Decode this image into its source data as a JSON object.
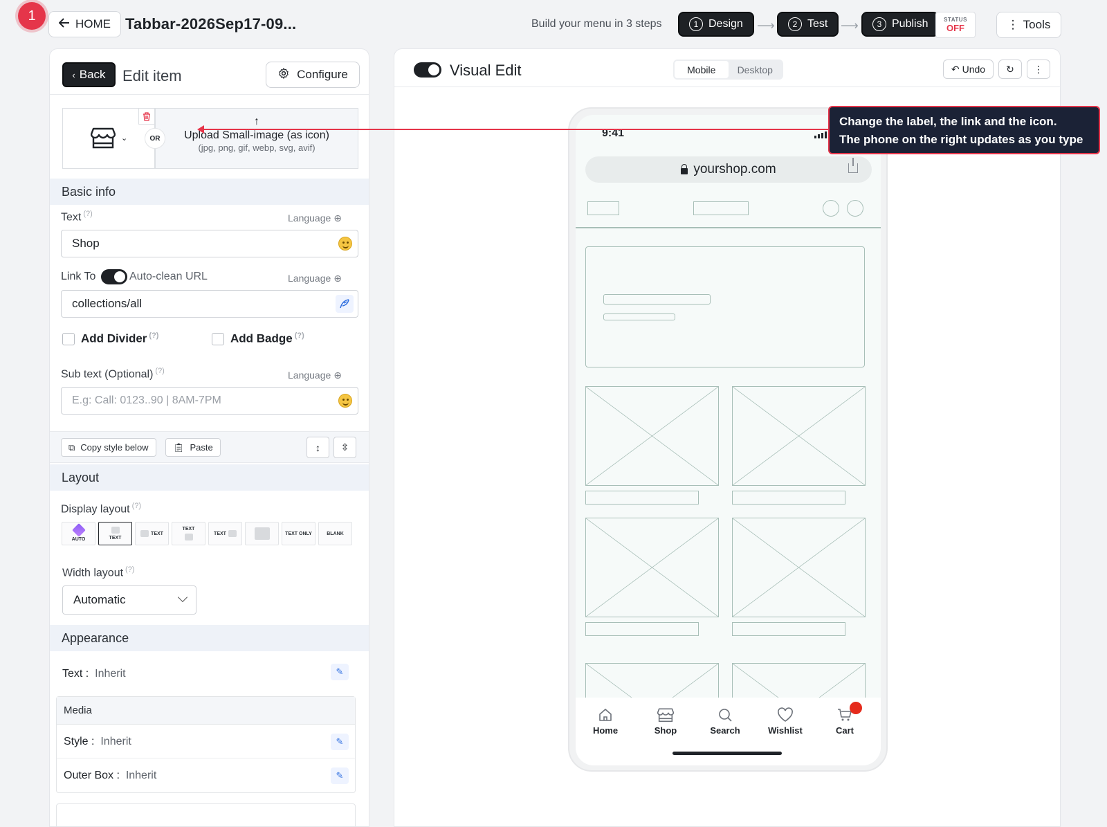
{
  "topbar": {
    "step_badge": "1",
    "home_label": "HOME",
    "doc_title": "Tabbar-2026Sep17-09...",
    "steps_label": "Build your menu in 3 steps",
    "steps": [
      {
        "num": "1",
        "label": "Design"
      },
      {
        "num": "2",
        "label": "Test"
      },
      {
        "num": "3",
        "label": "Publish"
      }
    ],
    "status_label": "STATUS",
    "status_value": "OFF",
    "tools_label": "Tools",
    "colors": {
      "accent": "#e5354a",
      "dark": "#1e2125",
      "panel_blue": "#eef2f8"
    }
  },
  "editor": {
    "back_label": "Back",
    "title": "Edit item",
    "configure_label": "Configure",
    "icon_name": "store-icon",
    "or_label": "OR",
    "upload_title": "Upload Small-image (as icon)",
    "upload_formats": "(jpg, png, gif, webp, svg, avif)",
    "basic_info": {
      "heading": "Basic info",
      "text_label": "Text",
      "help": "(?)",
      "language": "Language",
      "text_value": "Shop",
      "link_label": "Link To",
      "auto_clean_label": "Auto-clean URL",
      "link_value": "collections/all",
      "add_divider": "Add Divider",
      "add_badge": "Add Badge",
      "subtext_label": "Sub text (Optional)",
      "subtext_placeholder": "E.g: Call: 0123..90 | 8AM-7PM"
    },
    "tools": {
      "copy_label": "Copy style below",
      "paste_label": "Paste"
    },
    "layout": {
      "heading": "Layout",
      "display_label": "Display layout",
      "options": [
        "AUTO",
        "TEXT",
        "TEXT",
        "TEXT",
        "TEXT",
        "",
        "TEXT ONLY",
        "BLANK"
      ],
      "width_label": "Width layout",
      "width_value": "Automatic"
    },
    "appearance": {
      "heading": "Appearance",
      "text_key": "Text :",
      "text_value": "Inherit",
      "media_heading": "Media",
      "style_key": "Style :",
      "style_value": "Inherit",
      "outer_key": "Outer Box :",
      "outer_value": "Inherit"
    }
  },
  "preview": {
    "title": "Visual Edit",
    "modes": [
      "Mobile",
      "Desktop"
    ],
    "active_mode": "Mobile",
    "undo_label": "Undo",
    "phone": {
      "time": "9:41",
      "url": "yourshop.com",
      "tabs": [
        {
          "label": "Home",
          "icon": "home-icon"
        },
        {
          "label": "Shop",
          "icon": "store-icon"
        },
        {
          "label": "Search",
          "icon": "search-icon"
        },
        {
          "label": "Wishlist",
          "icon": "heart-icon"
        },
        {
          "label": "Cart",
          "icon": "cart-icon"
        }
      ]
    }
  },
  "tooltip": {
    "line1": "Change the label, the link and the icon.",
    "line2": "The phone on the right updates as you type"
  }
}
